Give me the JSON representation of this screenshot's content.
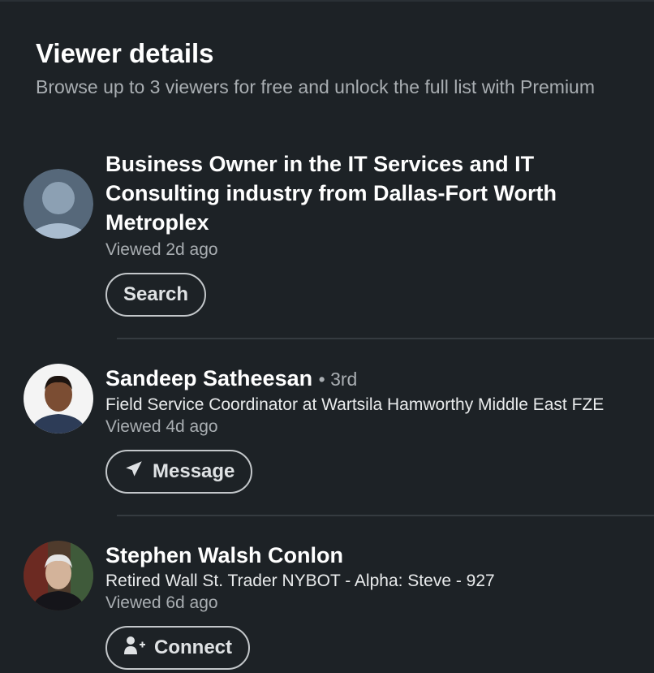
{
  "header": {
    "title": "Viewer details",
    "subtitle": "Browse up to 3 viewers for free and unlock the full list with Premium"
  },
  "viewers": [
    {
      "name": "Business Owner in the IT Services and IT Consulting industry from Dallas-Fort Worth Metroplex",
      "viewed": "Viewed 2d ago",
      "action": {
        "label": "Search",
        "icon": "none"
      }
    },
    {
      "name": "Sandeep Satheesan",
      "degree": "• 3rd",
      "headline": "Field Service Coordinator at Wartsila Hamworthy Middle East FZE",
      "viewed": "Viewed 4d ago",
      "action": {
        "label": "Message",
        "icon": "send-icon"
      }
    },
    {
      "name": "Stephen Walsh Conlon",
      "headline": "Retired Wall St. Trader NYBOT - Alpha: Steve - 927",
      "viewed": "Viewed 6d ago",
      "action": {
        "label": "Connect",
        "icon": "add-person-icon"
      }
    }
  ],
  "colors": {
    "background": "#1d2226",
    "primary_text": "#ffffff",
    "secondary_text": "#a9aeb2",
    "divider": "#353b40",
    "button_border": "#c3c7ca"
  }
}
